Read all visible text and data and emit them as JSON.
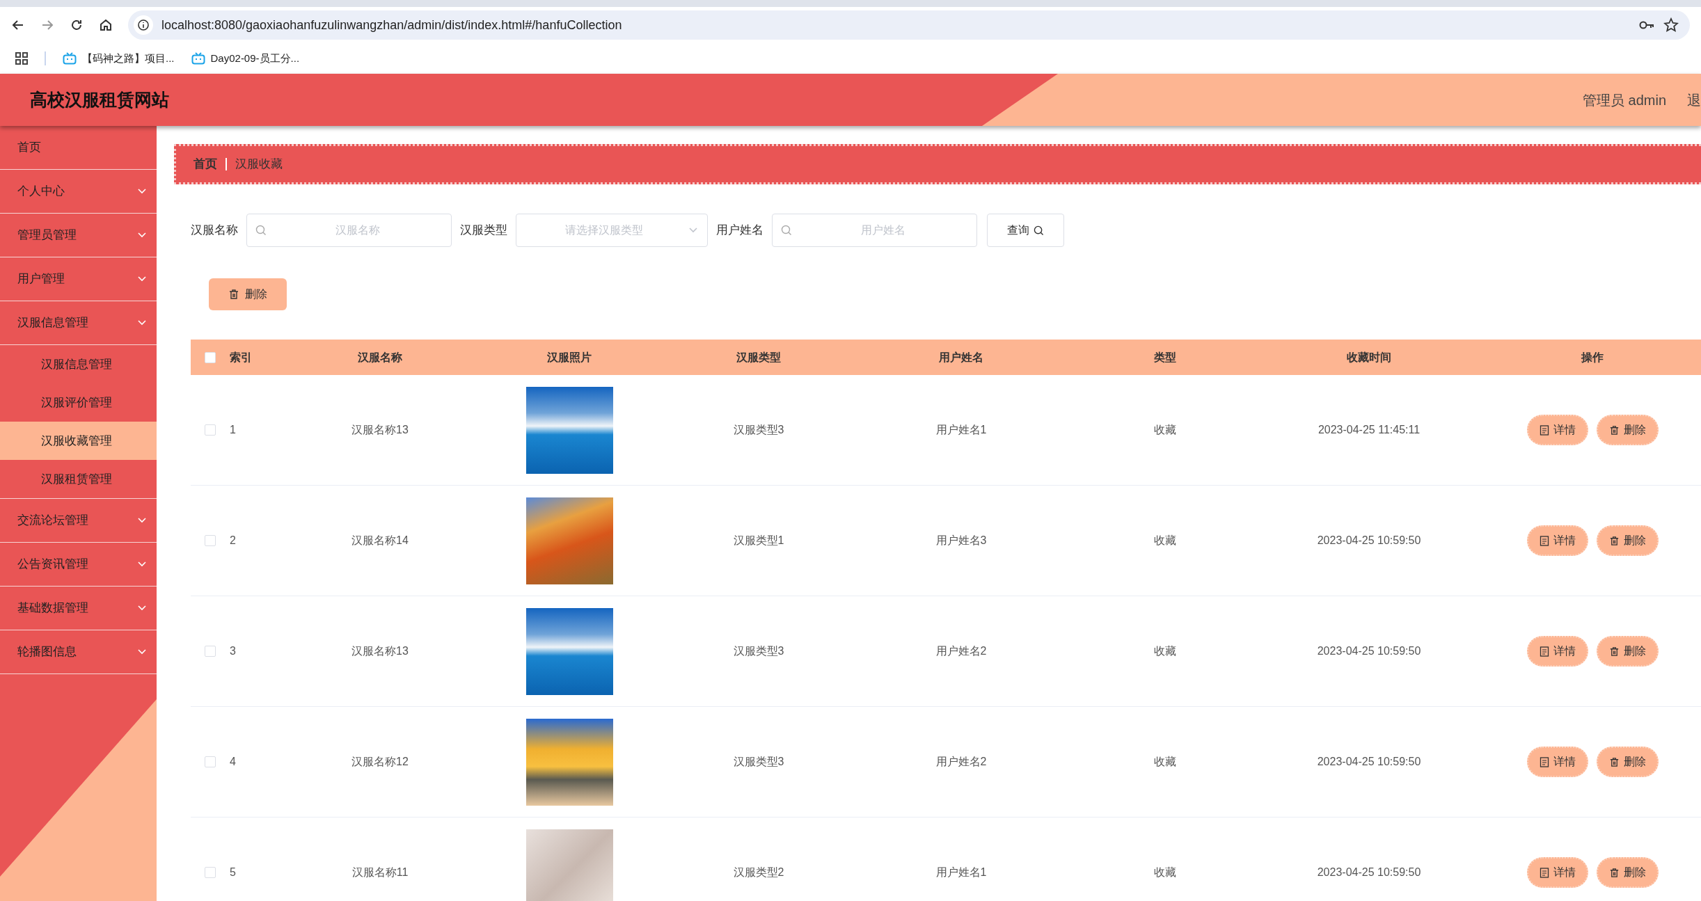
{
  "browser": {
    "url": "localhost:8080/gaoxiaohanfuzulinwangzhan/admin/dist/index.html#/hanfuCollection",
    "bookmarks": [
      "【码神之路】项目...",
      "Day02-09-员工分..."
    ]
  },
  "header": {
    "title": "高校汉服租赁网站",
    "user": "管理员 admin",
    "logout": "退"
  },
  "sidebar": {
    "items": [
      {
        "label": "首页",
        "kind": "link",
        "selected": false
      },
      {
        "label": "个人中心",
        "kind": "submenu",
        "selected": false
      },
      {
        "label": "管理员管理",
        "kind": "submenu",
        "selected": false
      },
      {
        "label": "用户管理",
        "kind": "submenu",
        "selected": false
      },
      {
        "label": "汉服信息管理",
        "kind": "submenu",
        "selected": false,
        "children": [
          {
            "label": "汉服信息管理",
            "selected": false
          },
          {
            "label": "汉服评价管理",
            "selected": false
          },
          {
            "label": "汉服收藏管理",
            "selected": true
          },
          {
            "label": "汉服租赁管理",
            "selected": false
          }
        ]
      },
      {
        "label": "交流论坛管理",
        "kind": "submenu",
        "selected": false
      },
      {
        "label": "公告资讯管理",
        "kind": "submenu",
        "selected": false
      },
      {
        "label": "基础数据管理",
        "kind": "submenu",
        "selected": false
      },
      {
        "label": "轮播图信息",
        "kind": "submenu",
        "selected": false
      }
    ]
  },
  "breadcrumb": [
    "首页",
    "汉服收藏"
  ],
  "filters": [
    {
      "kind": "input",
      "label": "汉服名称",
      "placeholder": "汉服名称"
    },
    {
      "kind": "select",
      "label": "汉服类型",
      "placeholder": "请选择汉服类型"
    },
    {
      "kind": "input",
      "label": "用户姓名",
      "placeholder": "用户姓名"
    }
  ],
  "search_button": "查询",
  "delete_button": "删除",
  "table": {
    "all_checked": false,
    "columns": [
      "索引",
      "汉服名称",
      "汉服照片",
      "汉服类型",
      "用户姓名",
      "类型",
      "收藏时间",
      "操作"
    ],
    "rows": [
      {
        "checked": false,
        "index": "1",
        "name": "汉服名称13",
        "type": "汉服类型3",
        "user": "用户姓名1",
        "kind": "收藏",
        "time": "2023-04-25 11:45:11",
        "actions": [
          "详情",
          "删除"
        ]
      },
      {
        "checked": false,
        "index": "2",
        "name": "汉服名称14",
        "type": "汉服类型1",
        "user": "用户姓名3",
        "kind": "收藏",
        "time": "2023-04-25 10:59:50",
        "actions": [
          "详情",
          "删除"
        ]
      },
      {
        "checked": false,
        "index": "3",
        "name": "汉服名称13",
        "type": "汉服类型3",
        "user": "用户姓名2",
        "kind": "收藏",
        "time": "2023-04-25 10:59:50",
        "actions": [
          "详情",
          "删除"
        ]
      },
      {
        "checked": false,
        "index": "4",
        "name": "汉服名称12",
        "type": "汉服类型3",
        "user": "用户姓名2",
        "kind": "收藏",
        "time": "2023-04-25 10:59:50",
        "actions": [
          "详情",
          "删除"
        ]
      },
      {
        "checked": false,
        "index": "5",
        "name": "汉服名称11",
        "type": "汉服类型2",
        "user": "用户姓名1",
        "kind": "收藏",
        "time": "2023-04-25 10:59:50",
        "actions": [
          "详情",
          "删除"
        ]
      }
    ]
  }
}
